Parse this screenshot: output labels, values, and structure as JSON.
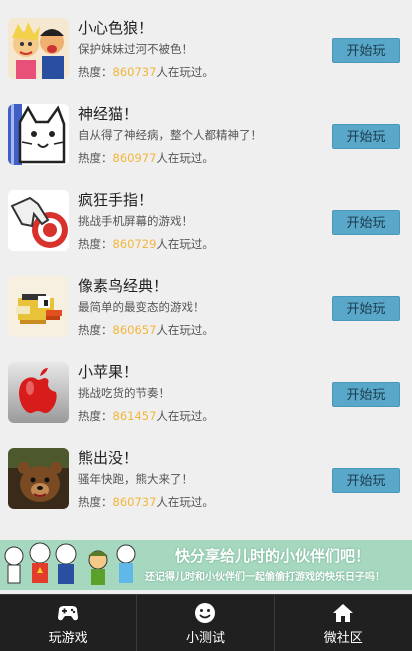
{
  "games": [
    {
      "title": "小心色狼！",
      "desc": "保护妹妹过河不被色！",
      "heat_prefix": "热度：",
      "heat_count": "860737",
      "heat_suffix": "人在玩过。",
      "button": "开始玩",
      "icon": "cartoon-couple-icon"
    },
    {
      "title": "神经猫！",
      "desc": "自从得了神经病，整个人都精神了！",
      "heat_prefix": "热度：",
      "heat_count": "860977",
      "heat_suffix": "人在玩过。",
      "button": "开始玩",
      "icon": "crazy-cat-icon"
    },
    {
      "title": "疯狂手指！",
      "desc": "挑战手机屏幕的游戏！",
      "heat_prefix": "热度：",
      "heat_count": "860729",
      "heat_suffix": "人在玩过。",
      "button": "开始玩",
      "icon": "finger-target-icon"
    },
    {
      "title": "像素鸟经典！",
      "desc": "最简单的最变态的游戏！",
      "heat_prefix": "热度：",
      "heat_count": "860657",
      "heat_suffix": "人在玩过。",
      "button": "开始玩",
      "icon": "pixel-bird-icon"
    },
    {
      "title": "小苹果！",
      "desc": "挑战吃货的节奏！",
      "heat_prefix": "热度：",
      "heat_count": "861457",
      "heat_suffix": "人在玩过。",
      "button": "开始玩",
      "icon": "red-apple-icon"
    },
    {
      "title": "熊出没！",
      "desc": "骚年快跑，熊大来了！",
      "heat_prefix": "热度：",
      "heat_count": "860737",
      "heat_suffix": "人在玩过。",
      "button": "开始玩",
      "icon": "bear-icon"
    }
  ],
  "banner": {
    "title": "快分享给儿时的小伙伴们吧！",
    "subtitle": "还记得儿时和小伙伴们一起偷偷打游戏的快乐日子吗！"
  },
  "tabs": [
    {
      "label": "玩游戏",
      "icon": "gamepad-icon"
    },
    {
      "label": "小测试",
      "icon": "smiley-icon"
    },
    {
      "label": "微社区",
      "icon": "house-icon"
    }
  ],
  "colors": {
    "accent_button": "#5aa8c9",
    "heat_number": "#f2b63a",
    "tabbar": "#202020",
    "banner": "#a6d8c0"
  }
}
